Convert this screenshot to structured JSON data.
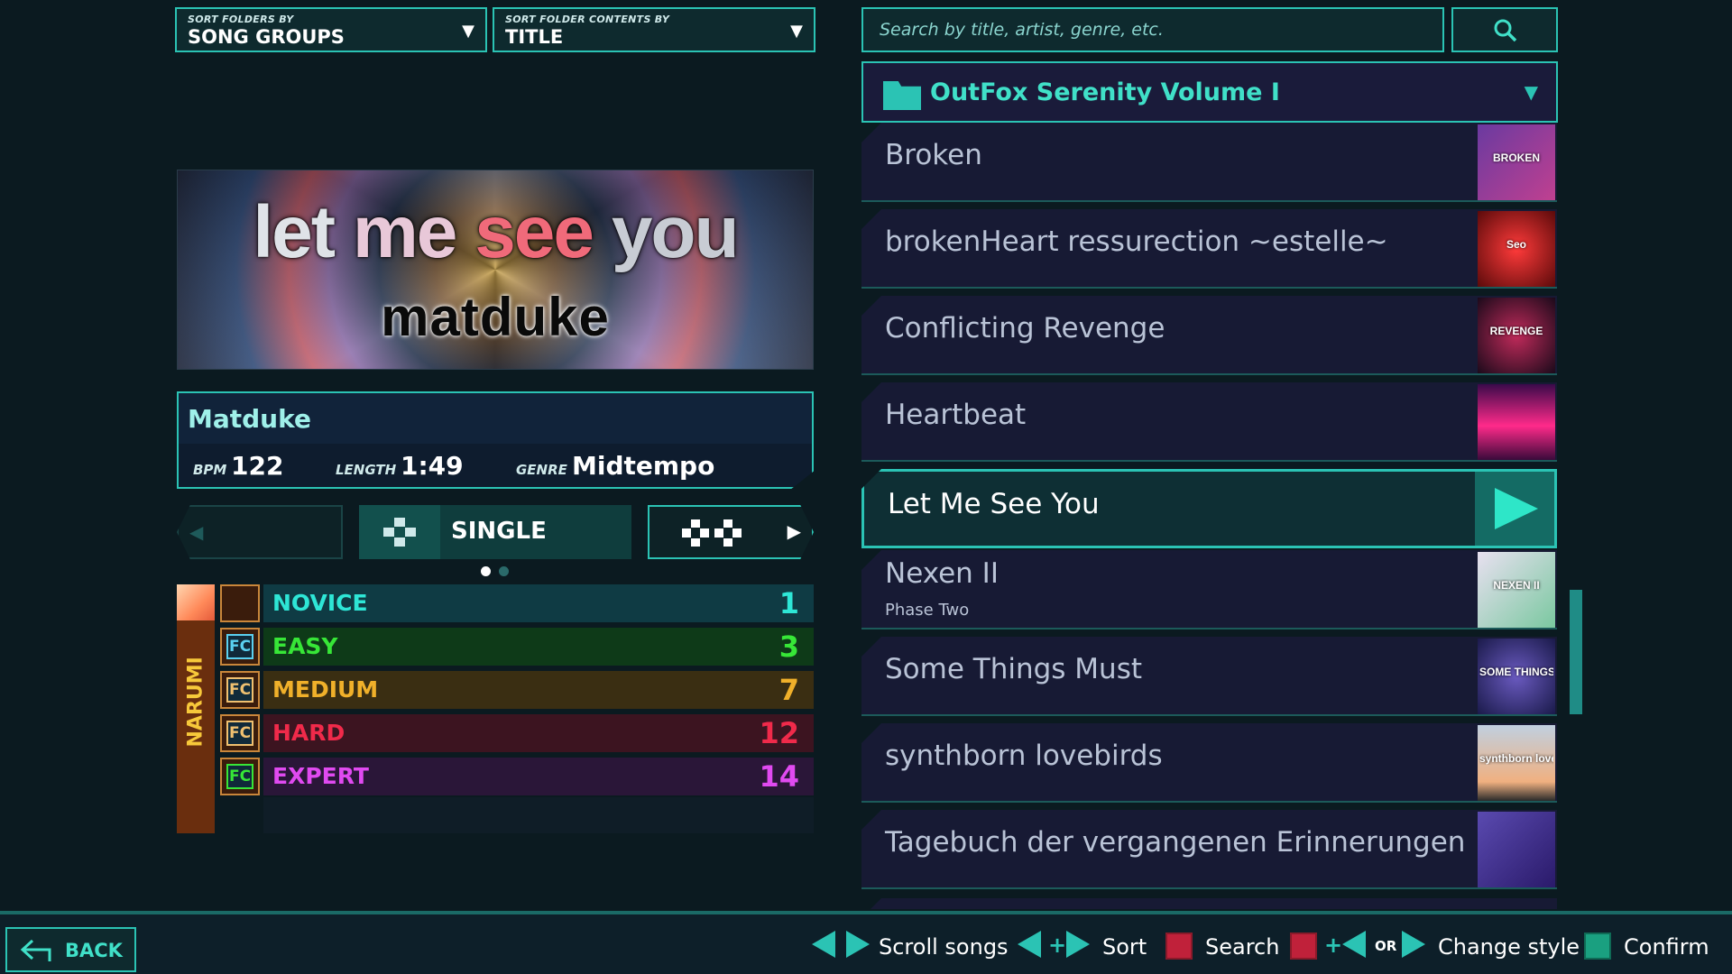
{
  "sort_folders": {
    "caption": "SORT FOLDERS BY",
    "value": "SONG GROUPS"
  },
  "sort_contents": {
    "caption": "SORT FOLDER CONTENTS BY",
    "value": "TITLE"
  },
  "banner": {
    "title": "let me see you",
    "artist_logo": "matduke"
  },
  "info": {
    "artist": "Matduke",
    "bpm_label": "BPM",
    "bpm": "122",
    "length_label": "LENGTH",
    "length": "1:49",
    "genre_label": "GENRE",
    "genre": "Midtempo"
  },
  "style": {
    "label": "SINGLE",
    "page_index": 0,
    "page_count": 2
  },
  "player": {
    "name": "NARUMI"
  },
  "difficulties": [
    {
      "name": "NOVICE",
      "meter": "1",
      "color": "#2ee6d6",
      "bg": "#0f3b44",
      "fc": "",
      "fc_color": ""
    },
    {
      "name": "EASY",
      "meter": "3",
      "color": "#37e637",
      "bg": "#0e3a18",
      "fc": "FC",
      "fc_color": "#5ad0f0"
    },
    {
      "name": "MEDIUM",
      "meter": "7",
      "color": "#f0b02a",
      "bg": "#3a2e12",
      "fc": "FC",
      "fc_color": "#f0c070"
    },
    {
      "name": "HARD",
      "meter": "12",
      "color": "#f02a4a",
      "bg": "#3c1420",
      "fc": "FC",
      "fc_color": "#f0c070"
    },
    {
      "name": "EXPERT",
      "meter": "14",
      "color": "#e04af0",
      "bg": "#2a1638",
      "fc": "FC",
      "fc_color": "#37e637"
    }
  ],
  "search": {
    "placeholder": "Search by title, artist, genre, etc."
  },
  "folder": {
    "title": "OutFox Serenity Volume I"
  },
  "songs": [
    {
      "title": "Broken",
      "subtitle": "",
      "thumb_text": "BROKEN",
      "thumb_bg": "linear-gradient(135deg,#6a3aa0,#c04090)"
    },
    {
      "title": "brokenHeart ressurection ~estelle~",
      "subtitle": "",
      "thumb_text": "Seo",
      "thumb_bg": "radial-gradient(circle,#ff3a3a,#5a0a0a)"
    },
    {
      "title": "Conflicting Revenge",
      "subtitle": "",
      "thumb_text": "REVENGE",
      "thumb_bg": "radial-gradient(circle,#c02a5a,#1a0a1a)"
    },
    {
      "title": "Heartbeat",
      "subtitle": "",
      "thumb_text": "",
      "thumb_bg": "linear-gradient(180deg,#3a0a4a,#ff2a8a 55%,#3a0a3a)"
    },
    {
      "title": "Let Me See You",
      "subtitle": "",
      "thumb_text": "",
      "thumb_bg": ""
    },
    {
      "title": "Nexen II",
      "subtitle": "Phase Two",
      "thumb_text": "NEXEN II",
      "thumb_bg": "linear-gradient(135deg,#e8e0f0,#7ac8a0)"
    },
    {
      "title": "Some Things Must",
      "subtitle": "",
      "thumb_text": "SOME THINGS MUST",
      "thumb_bg": "radial-gradient(circle,#6a5ac0,#1a1a4a)"
    },
    {
      "title": "synthborn lovebirds",
      "subtitle": "",
      "thumb_text": "synthborn lovebirds",
      "thumb_bg": "linear-gradient(180deg,#c0d0e0,#f0b080 75%,#2a2a2a)"
    },
    {
      "title": "Tagebuch der vergangenen Erinnerungen",
      "subtitle": "",
      "thumb_text": "",
      "thumb_bg": "linear-gradient(135deg,#5a4ab0,#2a1a6a)"
    }
  ],
  "footer": {
    "back": "BACK",
    "scroll": "Scroll songs",
    "sort": "Sort",
    "search": "Search",
    "or": "OR",
    "change_style": "Change style",
    "confirm": "Confirm",
    "search_color": "#c0213a",
    "confirm_color": "#1aa080"
  }
}
